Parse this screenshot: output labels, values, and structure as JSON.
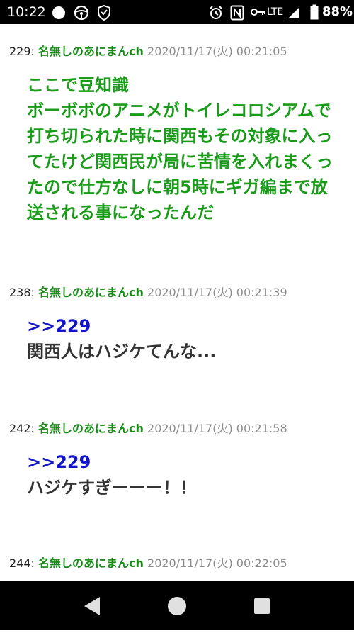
{
  "status_bar": {
    "time": "10:22",
    "network": "LTE",
    "battery": "88%",
    "icons": [
      "circle-icon",
      "steering-wheel-icon",
      "shield-icon",
      "alarm-icon",
      "nfc-icon",
      "vpn-key-icon",
      "signal-icon",
      "battery-icon"
    ]
  },
  "posts": [
    {
      "number": "229:",
      "name": "名無しのあにまんch",
      "date": "2020/11/17(火) 00:21:05",
      "anchor": "",
      "lines": [
        "ここで豆知識",
        "ボーボボのアニメがトイレコロシアムで",
        "打ち切られた時に関西もその対象に入っ",
        "てたけど関西民が局に苦情を入れまくっ",
        "たので仕方なしに朝5時にギガ編まで放",
        "送される事になったんだ"
      ]
    },
    {
      "number": "238:",
      "name": "名無しのあにまんch",
      "date": "2020/11/17(火) 00:21:39",
      "anchor": ">>229",
      "lines": [
        "関西人はハジケてんな..."
      ]
    },
    {
      "number": "242:",
      "name": "名無しのあにまんch",
      "date": "2020/11/17(火) 00:21:58",
      "anchor": ">>229",
      "lines": [
        "ハジケすぎーーー！！"
      ]
    },
    {
      "number": "244:",
      "name": "名無しのあにまんch",
      "date": "2020/11/17(火) 00:22:05",
      "anchor": "",
      "lines": []
    }
  ],
  "nav_bar": {
    "buttons": [
      "back-icon",
      "home-icon",
      "recents-icon"
    ]
  },
  "colors": {
    "name_green": "#1a8a1a",
    "body_green": "#1a9b1a",
    "anchor_blue": "#1515c8",
    "date_gray": "#8a8a8a"
  }
}
